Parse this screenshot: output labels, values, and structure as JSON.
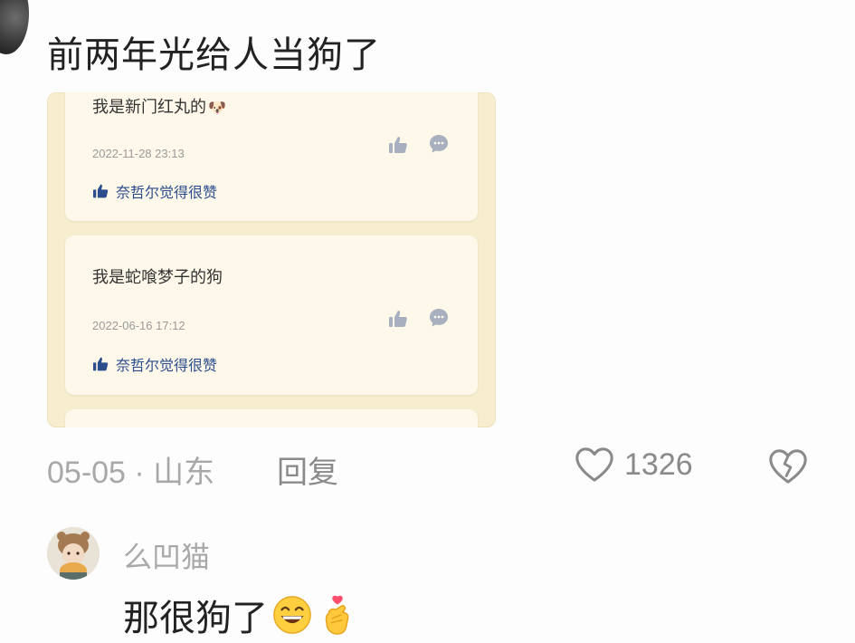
{
  "top_comment": {
    "text": "前两年光给人当狗了"
  },
  "embedded_image": {
    "cards": [
      {
        "text": "我是新门红丸的",
        "emoji": "🐶",
        "date": "2022-11-28 23:13",
        "liked_by": "奈哲尔觉得很赞"
      },
      {
        "text": "我是蛇喰梦子的狗",
        "date": "2022-06-16 17:12",
        "liked_by": "奈哲尔觉得很赞"
      }
    ],
    "colors": {
      "background": "#f7eed0",
      "card": "#fdf8e9",
      "liked_text": "#2b4d8e",
      "icon_gray": "#a8b0c0"
    }
  },
  "meta": {
    "date_location": "05-05 · 山东",
    "reply_label": "回复",
    "like_count": "1326"
  },
  "reply_comment": {
    "username": "么凹猫",
    "text": "那很狗了",
    "emojis": [
      "grinning-face-emoji",
      "heart-hand-emoji"
    ]
  }
}
